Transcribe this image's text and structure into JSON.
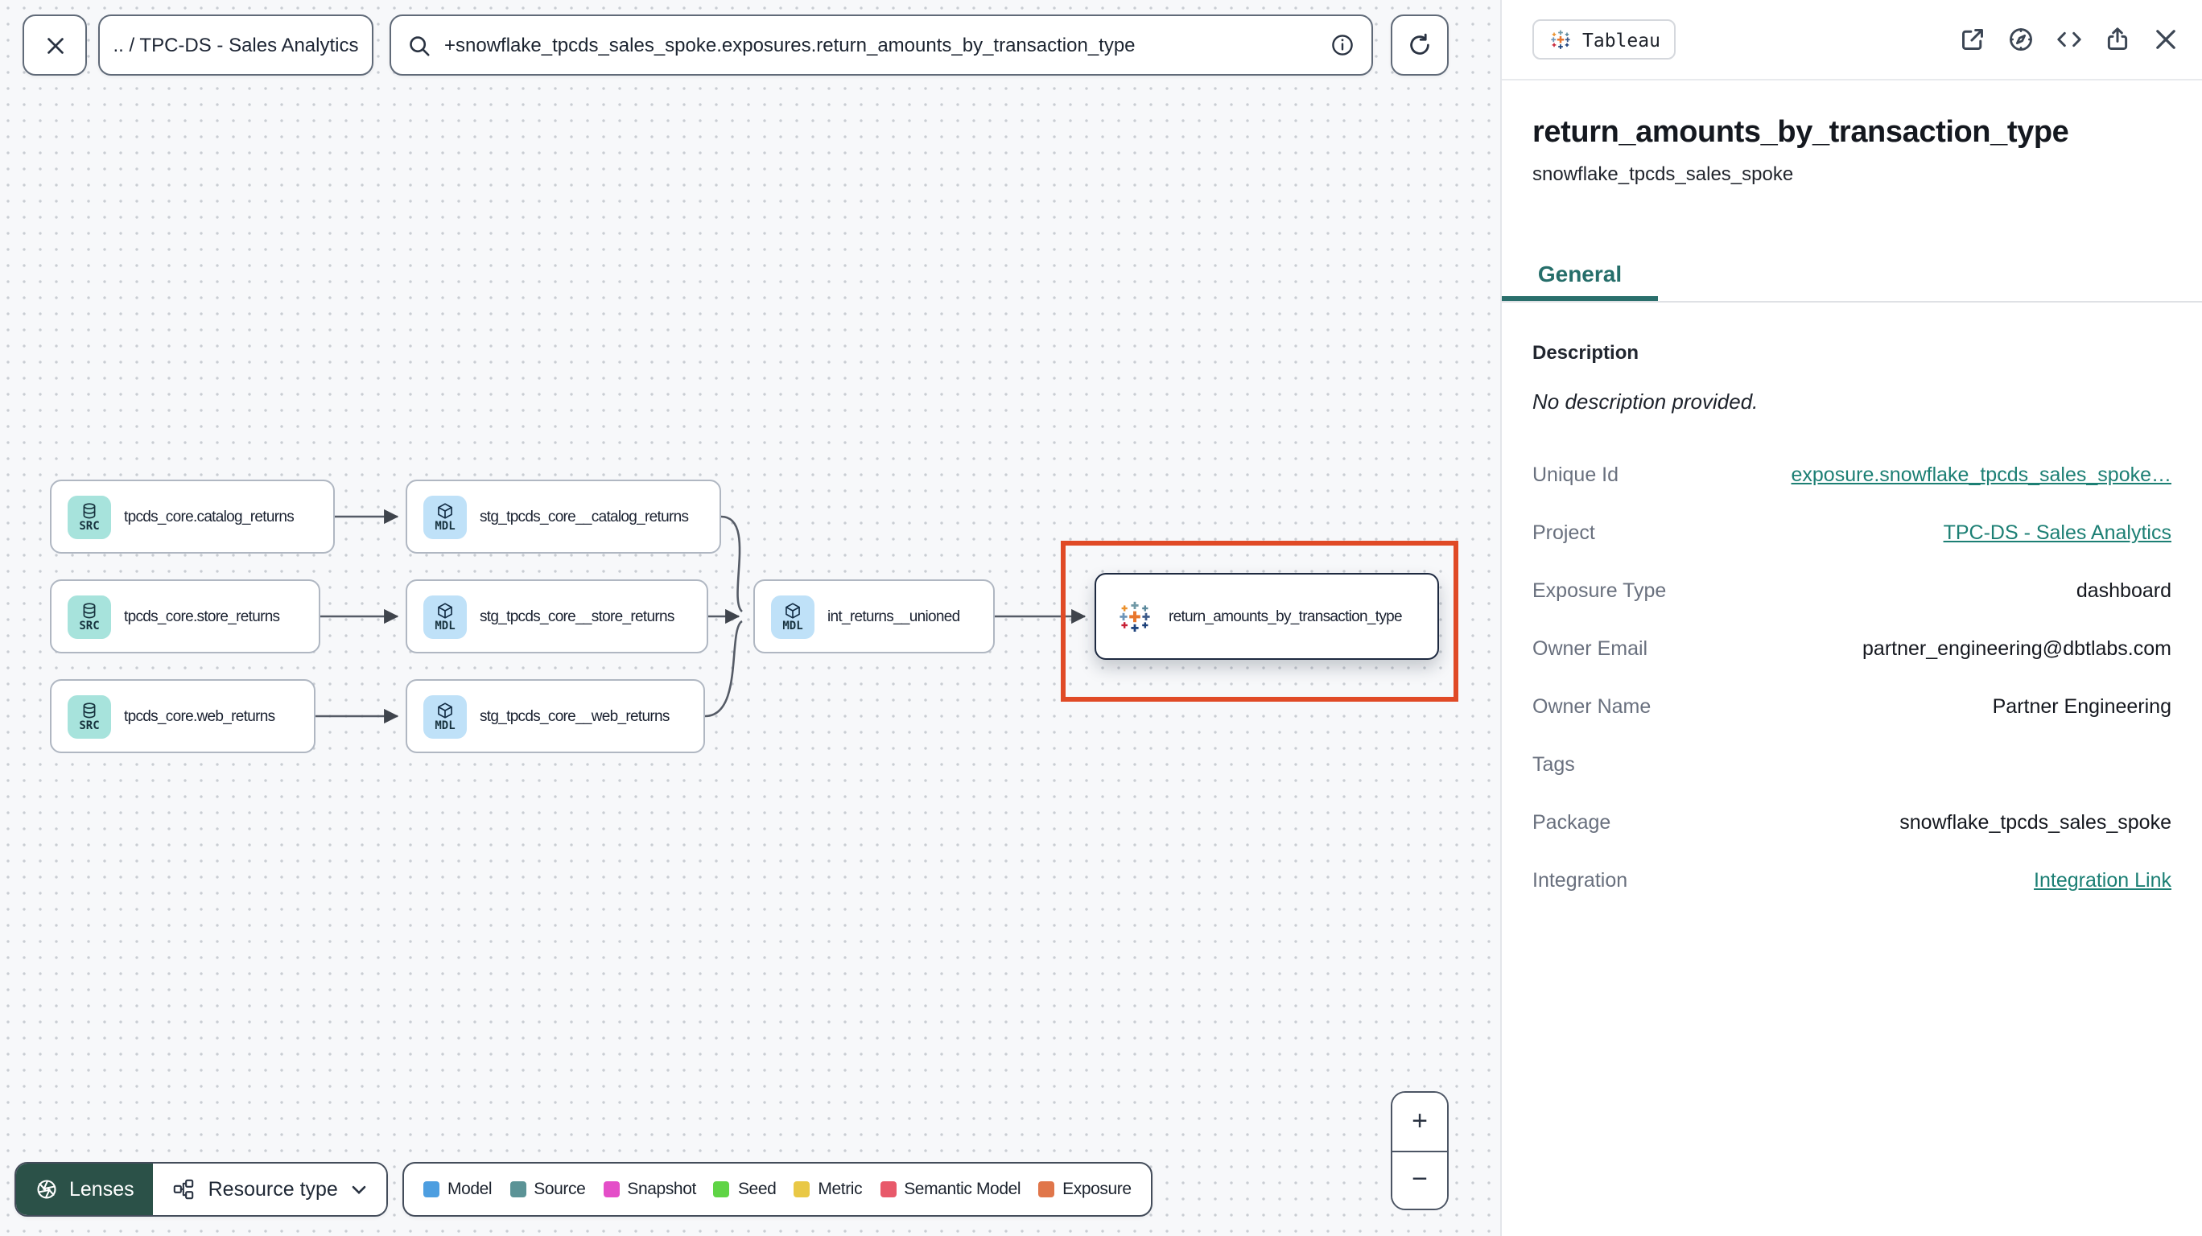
{
  "toolbar": {
    "breadcrumb": ".. / TPC-DS - Sales Analytics",
    "search_value": "+snowflake_tpcds_sales_spoke.exposures.return_amounts_by_transaction_type"
  },
  "graph": {
    "nodes": [
      {
        "badge": "SRC",
        "label": "tpcds_core.catalog_returns"
      },
      {
        "badge": "SRC",
        "label": "tpcds_core.store_returns"
      },
      {
        "badge": "SRC",
        "label": "tpcds_core.web_returns"
      },
      {
        "badge": "MDL",
        "label": "stg_tpcds_core__catalog_returns"
      },
      {
        "badge": "MDL",
        "label": "stg_tpcds_core__store_returns"
      },
      {
        "badge": "MDL",
        "label": "stg_tpcds_core__web_returns"
      },
      {
        "badge": "MDL",
        "label": "int_returns__unioned"
      },
      {
        "badge": "tableau",
        "label": "return_amounts_by_transaction_type"
      }
    ]
  },
  "controls": {
    "lenses": "Lenses",
    "resource_type": "Resource type",
    "zoom_in": "+",
    "zoom_out": "−"
  },
  "legend": {
    "items": [
      {
        "label": "Model",
        "color": "#4d9ee0"
      },
      {
        "label": "Source",
        "color": "#5b9396"
      },
      {
        "label": "Snapshot",
        "color": "#e44ec8"
      },
      {
        "label": "Seed",
        "color": "#5fd445"
      },
      {
        "label": "Metric",
        "color": "#e9c846"
      },
      {
        "label": "Semantic Model",
        "color": "#e8596a"
      },
      {
        "label": "Exposure",
        "color": "#e0764a"
      }
    ]
  },
  "panel": {
    "source_chip": "Tableau",
    "title": "return_amounts_by_transaction_type",
    "subtitle": "snowflake_tpcds_sales_spoke",
    "tab": "General",
    "description_label": "Description",
    "description_empty": "No description provided.",
    "fields": [
      {
        "label": "Unique Id",
        "value": "exposure.snowflake_tpcds_sales_spoke…"
      },
      {
        "label": "Project",
        "value": "TPC-DS - Sales Analytics"
      },
      {
        "label": "Exposure Type",
        "value": "dashboard"
      },
      {
        "label": "Owner Email",
        "value": "partner_engineering@dbtlabs.com"
      },
      {
        "label": "Owner Name",
        "value": "Partner Engineering"
      },
      {
        "label": "Tags",
        "value": ""
      },
      {
        "label": "Package",
        "value": "snowflake_tpcds_sales_spoke"
      },
      {
        "label": "Integration",
        "value": "Integration Link"
      }
    ]
  },
  "colors": {
    "accent_teal": "#1c7f74",
    "highlight_red": "#e04a26",
    "lenses_green": "#2b5148"
  }
}
